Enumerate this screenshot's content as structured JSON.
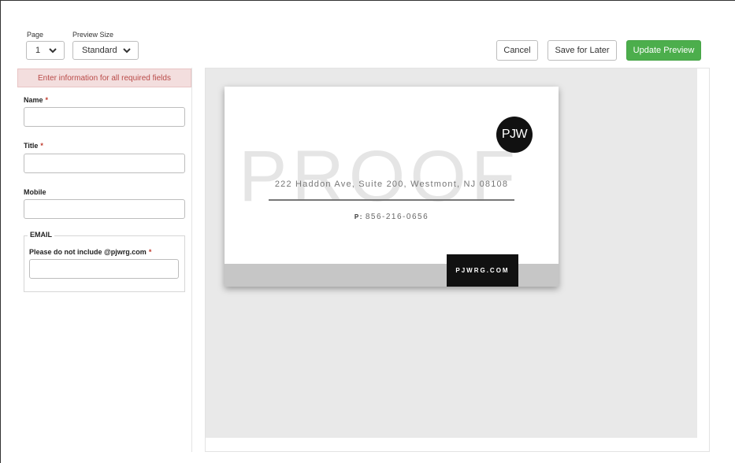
{
  "toolbar": {
    "page_label": "Page",
    "page_value": "1",
    "preview_size_label": "Preview Size",
    "preview_size_value": "Standard",
    "cancel_label": "Cancel",
    "save_later_label": "Save for Later",
    "update_preview_label": "Update Preview"
  },
  "form": {
    "alert": "Enter information for all required fields",
    "name_label": "Name",
    "title_label": "Title",
    "mobile_label": "Mobile",
    "email_legend": "EMAIL",
    "email_label": "Please do not include @pjwrg.com",
    "required_mark": "*",
    "name_value": "",
    "title_value": "",
    "mobile_value": "",
    "email_value": ""
  },
  "card": {
    "watermark": "PROOF",
    "logo_text": "PJW",
    "address": "222 Haddon Ave, Suite 200, Westmont, NJ 08108",
    "phone_prefix": "P:",
    "phone": "856-216-0656",
    "website": "PJWRG.COM"
  },
  "colors": {
    "primary_button": "#4cae4c",
    "alert_bg": "#f3dede",
    "alert_text": "#b94a48",
    "required": "#c0392b"
  },
  "icons": {
    "select_arrow": "chevron-down-icon"
  }
}
